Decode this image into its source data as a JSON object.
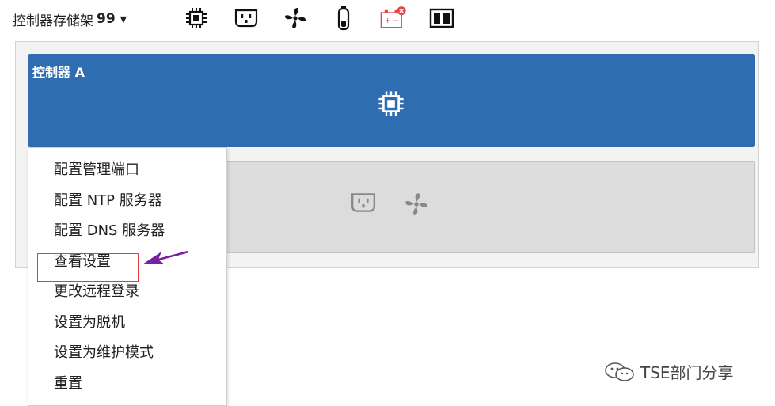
{
  "toolbar": {
    "shelf_label": "控制器存储架",
    "shelf_number": "99",
    "icons": [
      "chip-icon",
      "power-outlet-icon",
      "fan-icon",
      "battery-tube-icon",
      "battery-error-icon",
      "dual-panel-icon"
    ]
  },
  "controller_a": {
    "title": "控制器 A",
    "color": "#2e6db0"
  },
  "context_menu": {
    "items": [
      "配置管理端口",
      "配置 NTP 服务器",
      "配置 DNS 服务器",
      "查看设置",
      "更改远程登录",
      "设置为脱机",
      "设置为维护模式",
      "重置"
    ],
    "highlighted": "查看设置",
    "highlight_color": "#e03c3c",
    "arrow_color": "#7a1fa2"
  },
  "watermark": {
    "text": "TSE部门分享"
  }
}
